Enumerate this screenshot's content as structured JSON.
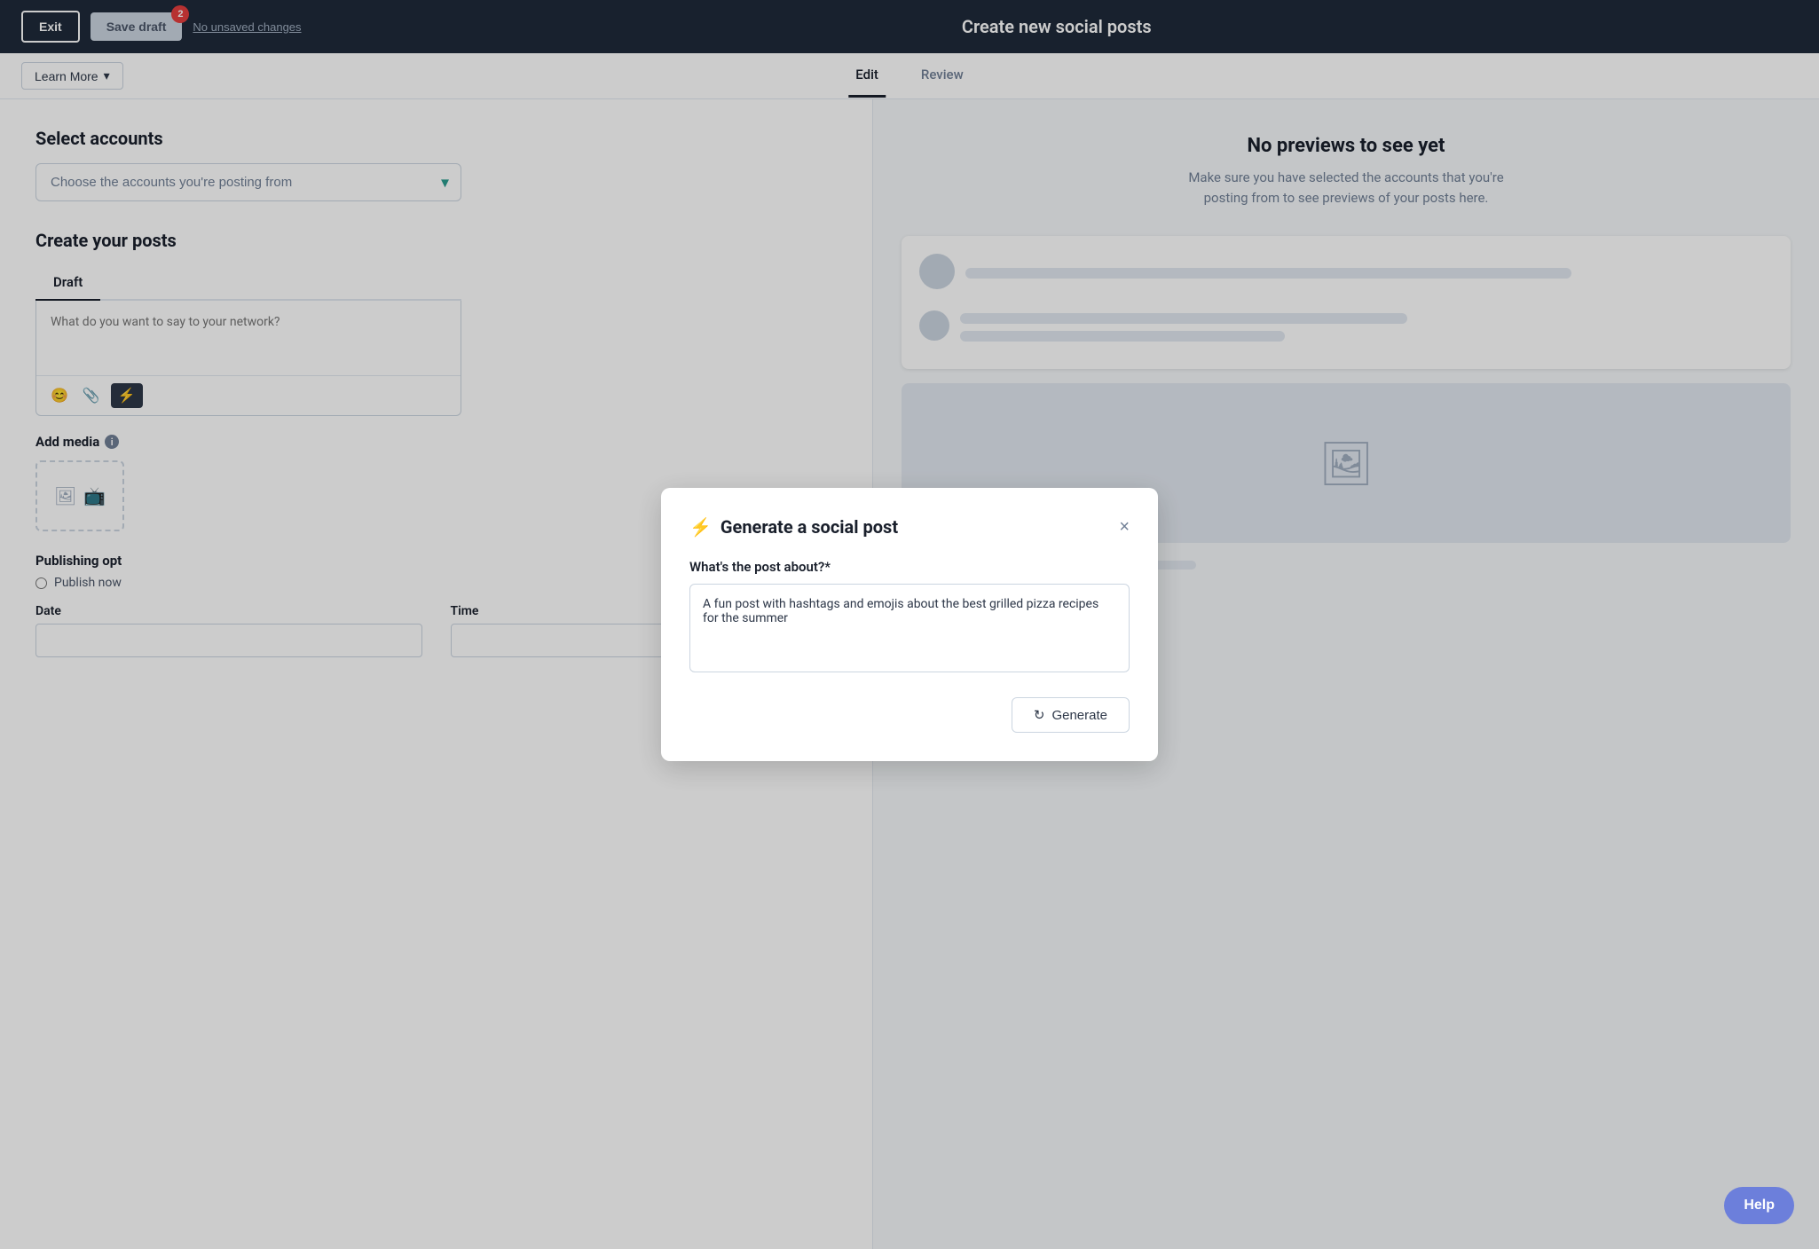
{
  "topNav": {
    "exitLabel": "Exit",
    "saveDraftLabel": "Save draft",
    "badgeCount": "2",
    "noUnsavedLabel": "No unsaved changes",
    "pageTitle": "Create new social posts"
  },
  "subNav": {
    "learnMoreLabel": "Learn More",
    "tabs": [
      {
        "id": "edit",
        "label": "Edit",
        "active": true
      },
      {
        "id": "review",
        "label": "Review",
        "active": false
      }
    ]
  },
  "leftPanel": {
    "selectAccountsTitle": "Select accounts",
    "accountSelectPlaceholder": "Choose the accounts you're posting from",
    "createPostsTitle": "Create your posts",
    "draftTabLabel": "Draft",
    "postTextareaPlaceholder": "What do you want to say to your network?",
    "toolbar": {
      "emojiLabel": "😊",
      "attachLabel": "📎",
      "aiLabel": "⚡"
    },
    "addMediaLabel": "Add media",
    "publishingLabel": "Publishing opt",
    "publishNowLabel": "Publish now",
    "dateLabel": "Date",
    "timeLabel": "Time"
  },
  "rightPanel": {
    "noPreviewTitle": "No previews to see yet",
    "noPreviewSubtitle": "Make sure you have selected the accounts that you're posting from to see previews of your posts here."
  },
  "modal": {
    "title": "Generate a social post",
    "lightningIcon": "⚡",
    "fieldLabel": "What's the post about?*",
    "textareaValue": "A fun post with hashtags and emojis about the best grilled pizza recipes for the summer",
    "generateLabel": "Generate",
    "generateIcon": "↻",
    "closeLabel": "×"
  },
  "helpButton": {
    "label": "Help"
  }
}
